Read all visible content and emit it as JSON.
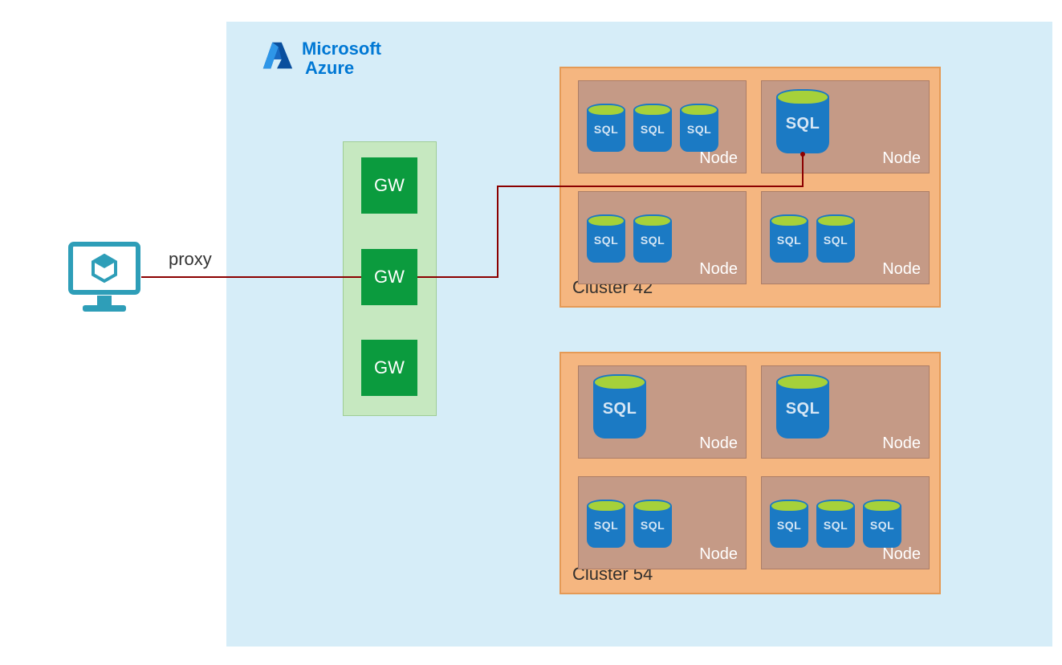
{
  "azure": {
    "brand_line1": "Microsoft",
    "brand_line2": "Azure"
  },
  "connection": {
    "proxy_label": "proxy"
  },
  "gateways": {
    "gw1": "GW",
    "gw2": "GW",
    "gw3": "GW"
  },
  "db_label": "SQL",
  "clusters": {
    "c42": {
      "label": "Cluster 42",
      "nodes": {
        "n1": {
          "label": "Node",
          "db_count": 3,
          "size": "small"
        },
        "n2": {
          "label": "Node",
          "db_count": 1,
          "size": "big"
        },
        "n3": {
          "label": "Node",
          "db_count": 2,
          "size": "small"
        },
        "n4": {
          "label": "Node",
          "db_count": 2,
          "size": "small"
        }
      }
    },
    "c54": {
      "label": "Cluster 54",
      "nodes": {
        "n1": {
          "label": "Node",
          "db_count": 1,
          "size": "big"
        },
        "n2": {
          "label": "Node",
          "db_count": 1,
          "size": "big"
        },
        "n3": {
          "label": "Node",
          "db_count": 2,
          "size": "small"
        },
        "n4": {
          "label": "Node",
          "db_count": 3,
          "size": "small"
        }
      }
    }
  },
  "colors": {
    "azure_bg": "#d6edf8",
    "gw_green": "#0b9b3e",
    "cluster_orange": "#f5b680",
    "node_brown": "#c59a86",
    "sql_blue": "#1b7ac4",
    "sql_lid": "#a6d13a",
    "wire_red": "#8b0000",
    "client_teal": "#2e9eb8"
  }
}
